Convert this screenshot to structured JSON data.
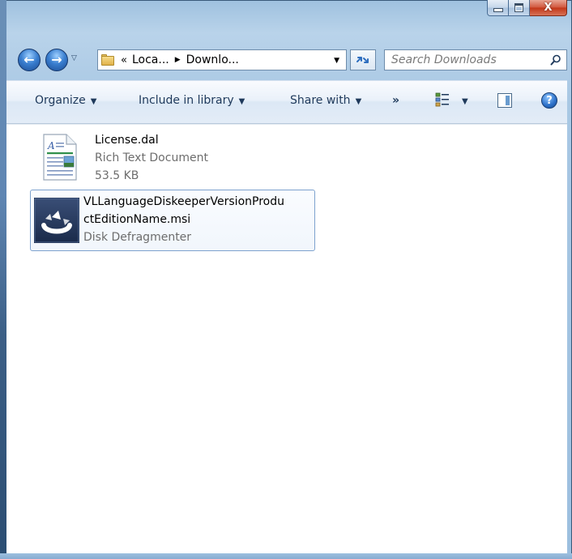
{
  "window": {
    "caption": {
      "minimize_label": "",
      "maximize_label": "",
      "close_label": "X"
    }
  },
  "nav": {
    "address": {
      "separator": "«",
      "parts": [
        "Loca...",
        "Downlo..."
      ]
    },
    "search": {
      "placeholder": "Search Downloads"
    }
  },
  "toolbar": {
    "organize": "Organize",
    "include": "Include in library",
    "share": "Share with",
    "more": "»"
  },
  "files": [
    {
      "name": "License.dal",
      "type": "Rich Text Document",
      "size": "53.5 KB",
      "icon": "rich-text-document-icon",
      "selected": false
    },
    {
      "name_line1": "VLLanguageDiskeeperVersionProdu",
      "name_line2": "ctEditionName.msi",
      "type": "Disk Defragmenter",
      "icon": "disk-defragmenter-icon",
      "selected": true
    }
  ],
  "colors": {
    "frame": "#a9c8e4",
    "command_bar": "#e3ecf7",
    "text_link": "#1e395b",
    "selection_border": "#7da2ce"
  }
}
